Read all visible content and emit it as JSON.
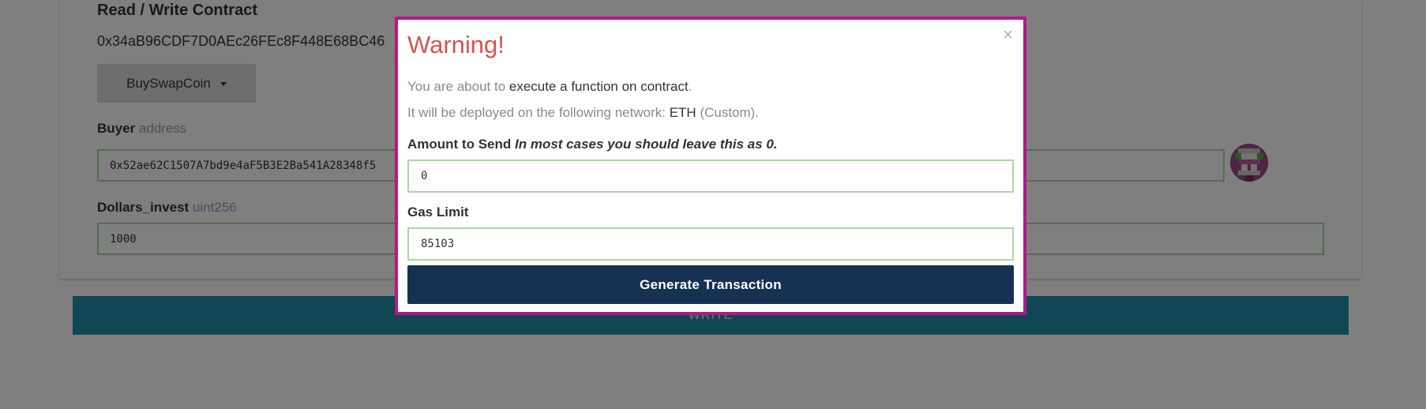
{
  "contract": {
    "section_title": "Read / Write Contract",
    "address": "0x34aB96CDF7D0AEc26FEc8F448E68BC46",
    "function_selected": "BuySwapCoin",
    "fields": [
      {
        "name": "Buyer",
        "type": "address",
        "value": "0x52ae62C1507A7bd9e4aF5B3E2Ba541A28348f5"
      },
      {
        "name": "Dollars_invest",
        "type": "uint256",
        "value": "1000"
      }
    ],
    "write_label": "WRITE"
  },
  "modal": {
    "title": "Warning!",
    "close_label": "×",
    "line1_prefix": "You are about to",
    "line1_emphasis": "execute a function on contract",
    "line1_suffix": ".",
    "line2_prefix": "It will be deployed on the following network:",
    "line2_network": "ETH",
    "line2_suffix": "(Custom).",
    "amount_label": "Amount to Send",
    "amount_hint": "In most cases you should leave this as 0.",
    "amount_value": "0",
    "gas_label": "Gas Limit",
    "gas_value": "85103",
    "generate_label": "Generate Transaction"
  },
  "colors": {
    "modal_border": "#b5178b",
    "warning_title": "#d9534f",
    "generate_button": "#163152",
    "write_button": "#1f8fa8",
    "input_border": "#a8d8a0"
  },
  "icons": {
    "close": "close-icon",
    "dropdown": "caret-down-icon",
    "avatar": "identicon-avatar"
  }
}
